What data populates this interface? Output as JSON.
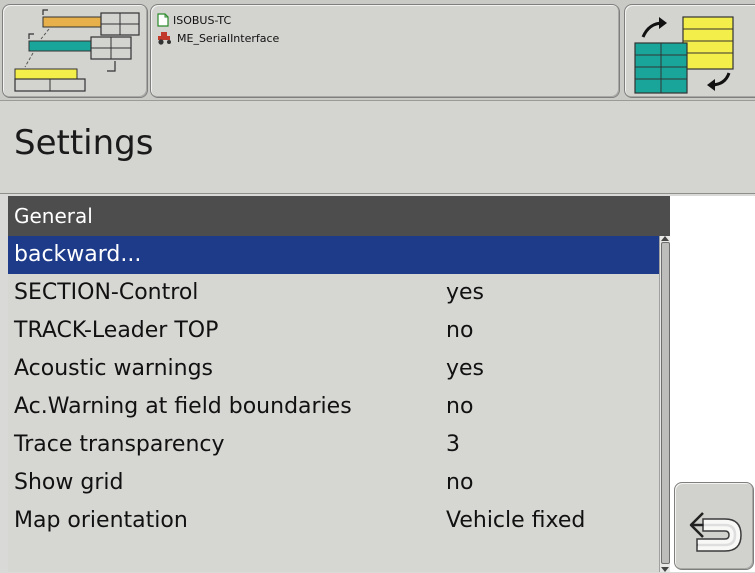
{
  "header": {
    "line1": "ISOBUS-TC",
    "line2": "ME_SerialInterface"
  },
  "title": "Settings",
  "list": {
    "header": "General",
    "items": [
      {
        "label": "backward...",
        "value": ""
      },
      {
        "label": "SECTION-Control",
        "value": "yes"
      },
      {
        "label": "TRACK-Leader TOP",
        "value": "no"
      },
      {
        "label": "Acoustic warnings",
        "value": "yes"
      },
      {
        "label": "Ac.Warning at field boundaries",
        "value": "no"
      },
      {
        "label": "Trace transparency",
        "value": "3"
      },
      {
        "label": "Show grid",
        "value": "no"
      },
      {
        "label": "Map orientation",
        "value": "Vehicle fixed"
      }
    ]
  },
  "colors": {
    "accent_selected": "#1e3b8a",
    "section_header": "#4d4d4d",
    "teal": "#1aa59b",
    "yellow": "#f4ee4a",
    "orange": "#e8b04a"
  },
  "icons": {
    "left_tile": "machine-layout-icon",
    "right_tile": "swap-layout-icon",
    "file": "document-icon",
    "machine": "tractor-icon",
    "back": "back-arrow-icon"
  }
}
